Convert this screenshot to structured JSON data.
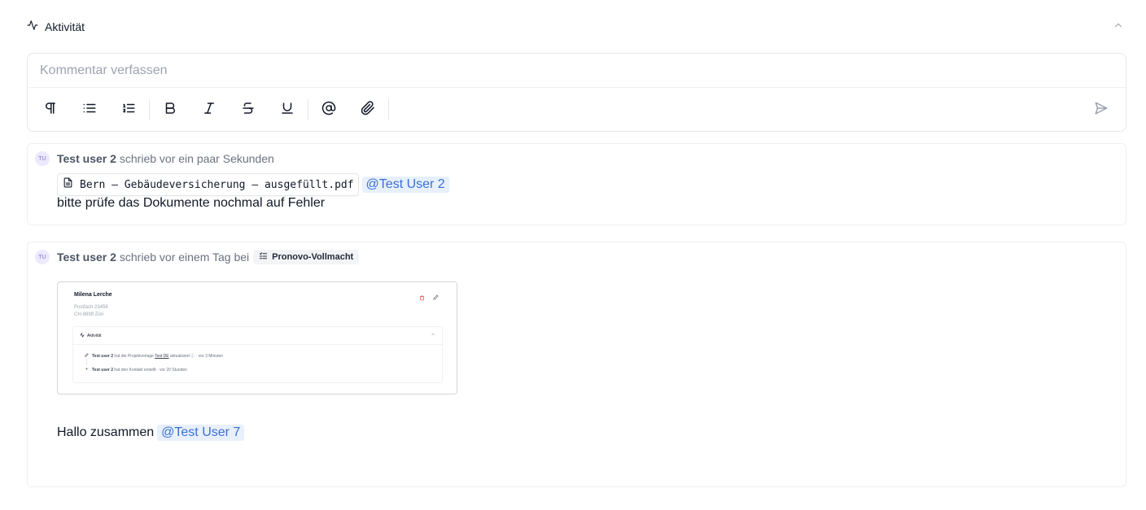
{
  "activity": {
    "title": "Aktivität",
    "icon": "activity-icon",
    "collapse_icon": "chevron-up-icon"
  },
  "editor": {
    "placeholder": "Kommentar verfassen",
    "value": "",
    "toolbar": [
      {
        "name": "paragraph",
        "icon": "pilcrow-icon"
      },
      {
        "name": "bullet-list",
        "icon": "bullet-list-icon"
      },
      {
        "name": "ordered-list",
        "icon": "ordered-list-icon"
      },
      {
        "name": "bold",
        "icon": "bold-icon"
      },
      {
        "name": "italic",
        "icon": "italic-icon"
      },
      {
        "name": "strikethrough",
        "icon": "strikethrough-icon"
      },
      {
        "name": "underline",
        "icon": "underline-icon"
      },
      {
        "name": "mention",
        "icon": "at-sign-icon"
      },
      {
        "name": "attach",
        "icon": "paperclip-icon"
      }
    ],
    "send_icon": "send-icon"
  },
  "comments": [
    {
      "avatar": "TU",
      "author": "Test user 2",
      "action": "schrieb vor ein paar Sekunden",
      "attachment": {
        "file_name": "Bern – Gebäudeversicherung – ausgefüllt.pdf",
        "icon": "file-icon"
      },
      "mention": "@Test User 2",
      "text": "bitte prüfe das Dokumente nochmal auf Fehler"
    },
    {
      "avatar": "TU",
      "author": "Test user 2",
      "action": "schrieb vor einem Tag bei",
      "reference": {
        "label": "Pronovo-Vollmacht",
        "icon": "checklist-icon"
      },
      "screenshot": {
        "name": "Milena Lerche",
        "address_line1": "Postfach 23456",
        "address_line2": "CH-9899 Züri",
        "panel_title": "Aktivität",
        "line1_author": "Test user 2",
        "line1_pre": "hat die Projektvorlage",
        "line1_link": "Test DE",
        "line1_post": "aktualisiert ⓘ · vor 3 Minuten",
        "line2_author": "Test user 2",
        "line2_post": "hat den Kontakt erstellt · vor 20 Stunden"
      },
      "text": "Hallo zusammen",
      "mention": "@Test User 7"
    }
  ]
}
